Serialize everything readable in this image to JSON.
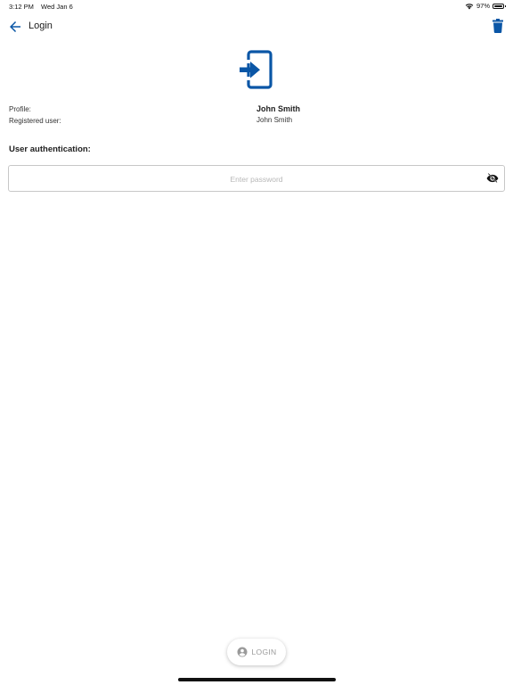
{
  "status_bar": {
    "time": "3:12 PM",
    "date": "Wed Jan 6",
    "battery": "97%",
    "icons": [
      "wifi-icon",
      "battery-icon"
    ]
  },
  "app_bar": {
    "title": "Login",
    "back_icon": "arrow-left-icon",
    "delete_icon": "trash-icon"
  },
  "hero": {
    "icon": "login-icon"
  },
  "profile": {
    "profile_label": "Profile:",
    "profile_value": "John Smith",
    "registered_label": "Registered user:",
    "registered_value": "John Smith"
  },
  "auth": {
    "section_title": "User authentication:",
    "password_value": "",
    "password_placeholder": "Enter password",
    "visibility_icon": "eye-off-icon"
  },
  "footer": {
    "login_label": "LOGIN",
    "login_icon": "account-circle-icon"
  },
  "colors": {
    "accent": "#0a56a6",
    "text": "#222222",
    "muted": "#9a9a9a",
    "border": "#c7c7c7"
  }
}
